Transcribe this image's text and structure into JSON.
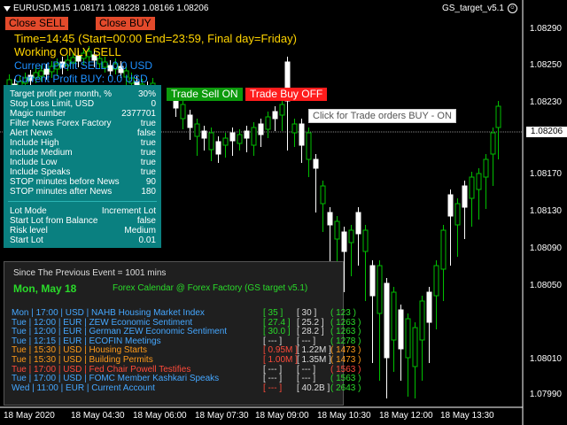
{
  "header": {
    "symbol": "EURUSD,M15",
    "ohlc": "1.08171 1.08228 1.08166 1.08206",
    "ea_name": "GS_target_v5.1"
  },
  "buttons": {
    "close_sell": "Close  SELL",
    "close_buy": "Close  BUY",
    "trade_sell": "Trade Sell ON",
    "trade_buy": "Trade Buy OFF"
  },
  "info": {
    "time_line": "Time=14:45 (Start=00:00 End=23:59, Final day=Friday)",
    "mode": "Working ONLY SELL",
    "profit_sell": "Current Profit SELL: 0.0 USD",
    "profit_buy": "Current Profit BUY: 0.0 USD"
  },
  "tooltip": "Click for Trade orders BUY - ON",
  "settings": [
    {
      "label": "Target profit per month, %",
      "value": "30%"
    },
    {
      "label": "Stop Loss Limit, USD",
      "value": "0"
    },
    {
      "label": "Magic number",
      "value": "2377701"
    },
    {
      "label": "Filter News Forex Factory",
      "value": "true"
    },
    {
      "label": "Alert News",
      "value": "false"
    },
    {
      "label": "Include High",
      "value": "true"
    },
    {
      "label": "Include Medium",
      "value": "true"
    },
    {
      "label": "Include Low",
      "value": "true"
    },
    {
      "label": "Include Speaks",
      "value": "true"
    },
    {
      "label": "STOP minutes before News",
      "value": "90"
    },
    {
      "label": "STOP minutes after  News",
      "value": "180"
    }
  ],
  "lot_settings": [
    {
      "label": "Lot Mode",
      "value": "Increment Lot"
    },
    {
      "label": "Start Lot from Balance",
      "value": "false"
    },
    {
      "label": "Risk level",
      "value": "Medium"
    },
    {
      "label": "Start Lot",
      "value": "0.01"
    }
  ],
  "prices": [
    "1.08290",
    "1.08250",
    "1.08206",
    "1.08170",
    "1.08130",
    "1.08090",
    "1.08050",
    "1.08010",
    "1.07990"
  ],
  "all_prices": [
    "1.08290",
    "1.08250",
    "1.08230",
    "1.08206",
    "1.08170",
    "1.08130",
    "1.08090",
    "1.08050",
    "1.08010",
    "1.07990"
  ],
  "current_price": "1.08206",
  "times": [
    "18 May 2020",
    "18 May 04:30",
    "18 May 06:00",
    "18 May 07:30",
    "18 May 09:00",
    "18 May 10:30",
    "18 May 12:00",
    "18 May 13:30"
  ],
  "news": {
    "since": "Since The Previous Event = 1001 mins",
    "date": "Mon, May 18",
    "calendar": "Forex Calendar @ Forex Factory  (GS target v5.1)",
    "rows": [
      {
        "day": "Mon",
        "time": "17:00",
        "cur": "USD",
        "event": "NAHB Housing Market Index",
        "f": "[ 35 ]",
        "p": "[ 30 ]",
        "m": "( 123 )",
        "color": "blue",
        "fcolor": "green"
      },
      {
        "day": "Tue",
        "time": "12:00",
        "cur": "EUR",
        "event": "ZEW Economic Sentiment",
        "f": "[ 27.4 ]",
        "p": "[ 25.2 ]",
        "m": "( 1263 )",
        "color": "blue",
        "fcolor": "green"
      },
      {
        "day": "Tue",
        "time": "12:00",
        "cur": "EUR",
        "event": "German ZEW Economic Sentiment",
        "f": "[ 30.0 ]",
        "p": "[ 28.2 ]",
        "m": "( 1263 )",
        "color": "blue",
        "fcolor": "green"
      },
      {
        "day": "Tue",
        "time": "12:15",
        "cur": "EUR",
        "event": "ECOFIN Meetings",
        "f": "[ --- ]",
        "p": "[ --- ]",
        "m": "( 1278 )",
        "color": "blue",
        "fcolor": "dim"
      },
      {
        "day": "Tue",
        "time": "15:30",
        "cur": "USD",
        "event": "Housing Starts",
        "f": "[ 0.95M ]",
        "p": "[ 1.22M ]",
        "m": "( 1473 )",
        "color": "orange",
        "fcolor": "red"
      },
      {
        "day": "Tue",
        "time": "15:30",
        "cur": "USD",
        "event": "Building Permits",
        "f": "[ 1.00M ]",
        "p": "[ 1.35M ]",
        "m": "( 1473 )",
        "color": "orange",
        "fcolor": "red"
      },
      {
        "day": "Tue",
        "time": "17:00",
        "cur": "USD",
        "event": "Fed Chair Powell Testifies",
        "f": "[ --- ]",
        "p": "[ --- ]",
        "m": "( 1563 )",
        "color": "red",
        "fcolor": "dim"
      },
      {
        "day": "Tue",
        "time": "17:00",
        "cur": "USD",
        "event": "FOMC Member Kashkari Speaks",
        "f": "[ --- ]",
        "p": "[ --- ]",
        "m": "( 1563 )",
        "color": "blue",
        "fcolor": "dim"
      },
      {
        "day": "Wed",
        "time": "11:00",
        "cur": "EUR",
        "event": "Current Account",
        "f": "[ --- ]",
        "p": "[ 40.2B ]",
        "m": "( 2643 )",
        "color": "blue",
        "fcolor": "red"
      }
    ]
  },
  "colors": {
    "bull": "#00c000",
    "bear": "#ffffff",
    "panel": "#0a8080",
    "accent": "#ffd400"
  }
}
